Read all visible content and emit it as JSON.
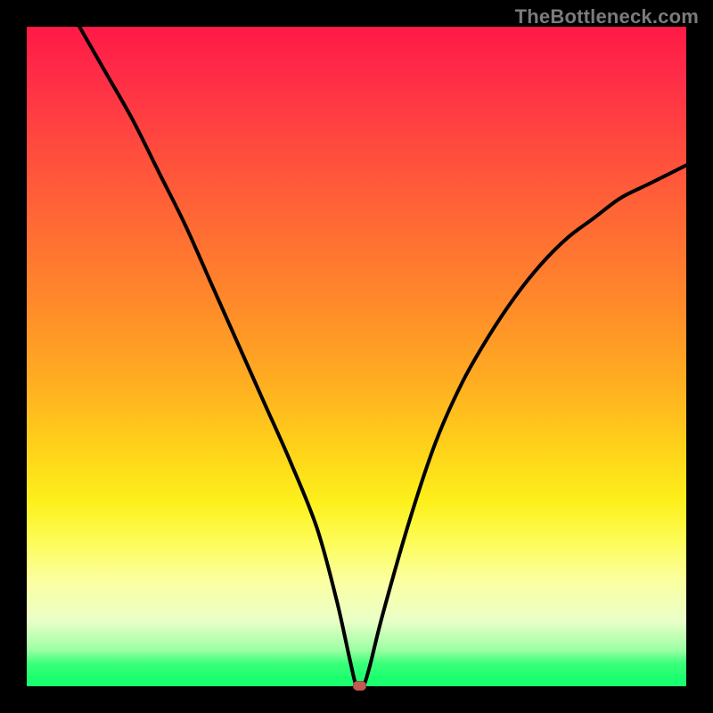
{
  "watermark": "TheBottleneck.com",
  "chart_data": {
    "type": "line",
    "title": "",
    "xlabel": "",
    "ylabel": "",
    "xlim": [
      0,
      100
    ],
    "ylim": [
      0,
      100
    ],
    "x": [
      8,
      12,
      16,
      20,
      24,
      28,
      32,
      36,
      40,
      44,
      47,
      49,
      50,
      51,
      52,
      54,
      58,
      62,
      66,
      70,
      74,
      78,
      82,
      86,
      90,
      94,
      98,
      100
    ],
    "values": [
      100,
      93,
      86,
      78,
      70,
      61,
      52,
      43,
      34,
      24,
      13,
      4,
      0,
      0,
      3,
      11,
      25,
      37,
      46,
      53,
      59,
      64,
      68,
      71,
      74,
      76,
      78,
      79
    ],
    "marker": {
      "x": 50.5,
      "y": 0
    },
    "notes": "V-shaped bottleneck curve; minimum at x≈50–51 touching y=0. Left branch reaches y=100 near x≈8; right branch rises to y≈79 at x=100. Background is a vertical spectrum gradient red→green with no axis ticks."
  },
  "colors": {
    "curve": "#000000",
    "marker": "#c25a52",
    "frame": "#000000"
  }
}
